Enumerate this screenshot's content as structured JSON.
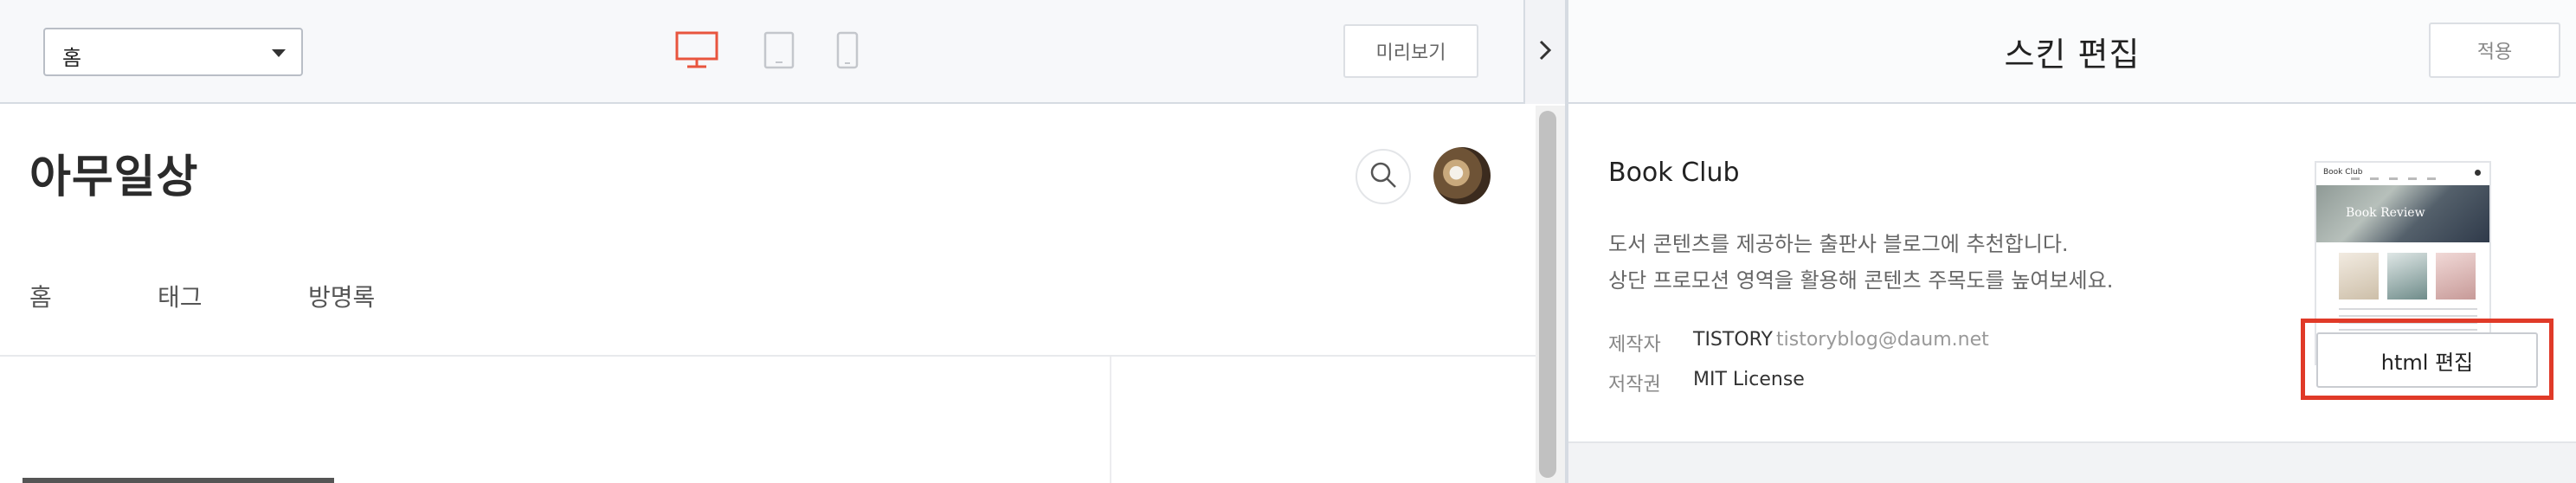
{
  "editor": {
    "page_select": {
      "value": "홈"
    },
    "devices": [
      "desktop",
      "tablet",
      "mobile"
    ],
    "active_device": "desktop",
    "preview_label": "미리보기"
  },
  "blog": {
    "title": "아무일상",
    "nav": [
      "홈",
      "태그",
      "방명록"
    ]
  },
  "skin_panel": {
    "title": "스킨 편집",
    "apply_label": "적용",
    "skin_name": "Book Club",
    "description": [
      "도서 콘텐츠를 제공하는 출판사 블로그에 추천합니다.",
      "상단 프로모션 영역을 활용해 콘텐츠 주목도를 높여보세요."
    ],
    "maker_label": "제작자",
    "maker": "TISTORY",
    "maker_email": "tistoryblog@daum.net",
    "license_label": "저작권",
    "license": "MIT License",
    "thumbnail": {
      "logo": "Book Club",
      "hero": "Book Review"
    },
    "html_edit_label": "html 편집"
  },
  "colors": {
    "accent": "#e8553e",
    "highlight": "#e03a28"
  },
  "icons": {
    "device_desktop": "monitor-icon",
    "device_tablet": "tablet-icon",
    "device_mobile": "phone-icon",
    "collapse": "chevron-right-icon",
    "search": "search-icon"
  }
}
